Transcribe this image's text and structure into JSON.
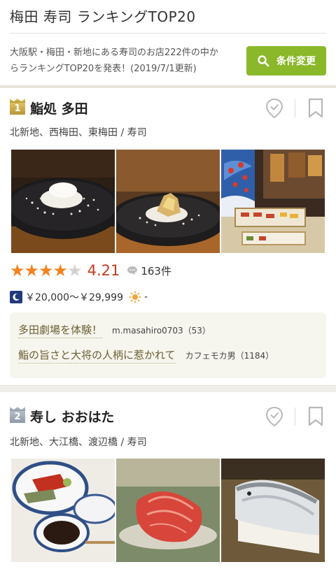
{
  "header": {
    "title": "梅田 寿司 ランキングTOP20"
  },
  "summary": {
    "line1": "大阪駅・梅田・新地にある寿司のお店222件の中か",
    "line2": "らランキングTOP20を発表！(2019/7/1更新)",
    "button_label": "条件変更"
  },
  "restaurants": [
    {
      "rank": "1",
      "name": "鮨処 多田",
      "area": "北新地、西梅田、東梅田 / 寿司",
      "rating": 4.21,
      "rating_label": "4.21",
      "stars_filled": 4,
      "review_count": "163件",
      "price_dinner": "￥20,000～￥29,999",
      "price_lunch": "-",
      "reviews": [
        {
          "title": "多田劇場を体験！",
          "user": "m.masahiro0703（53）"
        },
        {
          "title": "鮨の旨さと大将の人柄に惹かれて",
          "user": "カフェモカ男（1184）"
        }
      ]
    },
    {
      "rank": "2",
      "name": "寿し おおはた",
      "area": "北新地、大江橋、渡辺橋 / 寿司"
    }
  ],
  "colors": {
    "accent_green": "#8bb82a",
    "score_red": "#c43b1e",
    "star_orange": "#f3821f",
    "rank_gold": "#c9a846",
    "rank_silver": "#9aa5b4"
  },
  "icons": [
    "search-icon",
    "map-pin-icon",
    "bookmark-icon",
    "moon-icon",
    "sun-icon",
    "speech-bubble-icon",
    "star-icon"
  ]
}
